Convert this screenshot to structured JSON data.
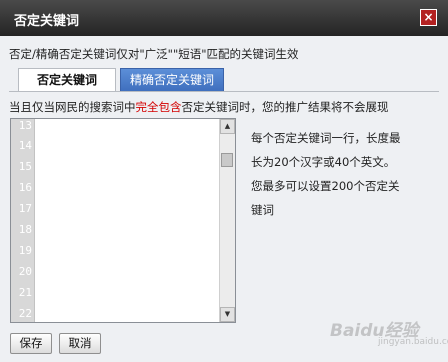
{
  "dialog": {
    "title": "否定关键词",
    "close_label": "×",
    "description": "否定/精确否定关键词仅对\"广泛\"\"短语\"匹配的关键词生效"
  },
  "tabs": [
    {
      "label": "否定关键词",
      "active": true
    },
    {
      "label": "精确否定关键词",
      "active": false
    }
  ],
  "notice": {
    "prefix": "当且仅当网民的搜索词中",
    "highlight": "完全包含",
    "suffix": "否定关键词时，您的推广结果将不会展现"
  },
  "editor": {
    "line_numbers": [
      "13",
      "14",
      "15",
      "16",
      "17",
      "18",
      "19",
      "20",
      "21",
      "22"
    ],
    "value": "",
    "scroll_position": 0.12
  },
  "help": {
    "line1": "每个否定关键词一行，长度最",
    "line2": "长为20个汉字或40个英文。",
    "line3": "您最多可以设置200个否定关",
    "line4": "键词"
  },
  "buttons": {
    "save": "保存",
    "cancel": "取消"
  },
  "watermark": {
    "text": "Baidu经验",
    "sub": "jingyan.baidu.com"
  },
  "colors": {
    "title_bar": "#2e2e2e",
    "highlight": "#d40000",
    "inactive_tab": "#4a7fcf",
    "close_button": "#b32121"
  }
}
